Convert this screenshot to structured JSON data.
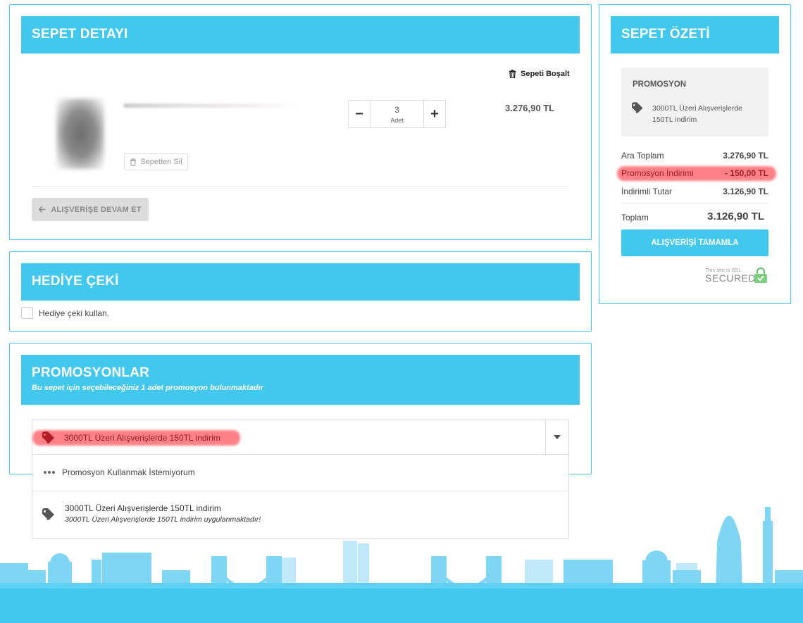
{
  "colors": {
    "accent": "#42c8ef",
    "accent_border": "#42c4ee",
    "highlight": "#ff6b73",
    "grey_button": "#dcdcdc"
  },
  "cart": {
    "title": "SEPET DETAYI",
    "empty_cart_label": "Sepeti Boşalt",
    "item": {
      "quantity": "3",
      "quantity_unit": "Adet",
      "price": "3.276,90 TL",
      "remove_label": "Sepetten Sil"
    },
    "continue_label": "ALIŞVERİŞE DEVAM ET"
  },
  "gift": {
    "title": "HEDİYE ÇEKİ",
    "checkbox_label": "Hediye çeki kullan."
  },
  "promotions": {
    "title": "PROMOSYONLAR",
    "subtitle": "Bu sepet için seçebileceğiniz 1 adet promosyon bulunmaktadır",
    "selected": "3000TL Üzeri Alışverişlerde 150TL indirim",
    "options": [
      {
        "label": "Promosyon Kullanmak İstemiyorum",
        "icon": "ellipsis-icon",
        "description": ""
      },
      {
        "label": "3000TL Üzeri Alışverişlerde 150TL indirim",
        "icon": "tag-icon",
        "description": "3000TL Üzeri Alışverişlerde 150TL indirim uygulanmaktadır!"
      }
    ]
  },
  "summary": {
    "title": "SEPET ÖZETİ",
    "promo_heading": "PROMOSYON",
    "promo_text_line1": "3000TL Üzeri Alışverişlerde",
    "promo_text_line2": "150TL indirim",
    "subtotal_label": "Ara Toplam",
    "subtotal_value": "3.276,90 TL",
    "discount_label": "Promosyon İndirimi",
    "discount_value": "- 150,00 TL",
    "discounted_label": "İndirimli Tutar",
    "discounted_value": "3.126,90 TL",
    "total_label": "Toplam",
    "total_value": "3.126,90 TL",
    "complete_label": "ALIŞVERİŞİ TAMAMLA",
    "ssl_small": "This site is SSL",
    "ssl_big": "SECURED"
  }
}
